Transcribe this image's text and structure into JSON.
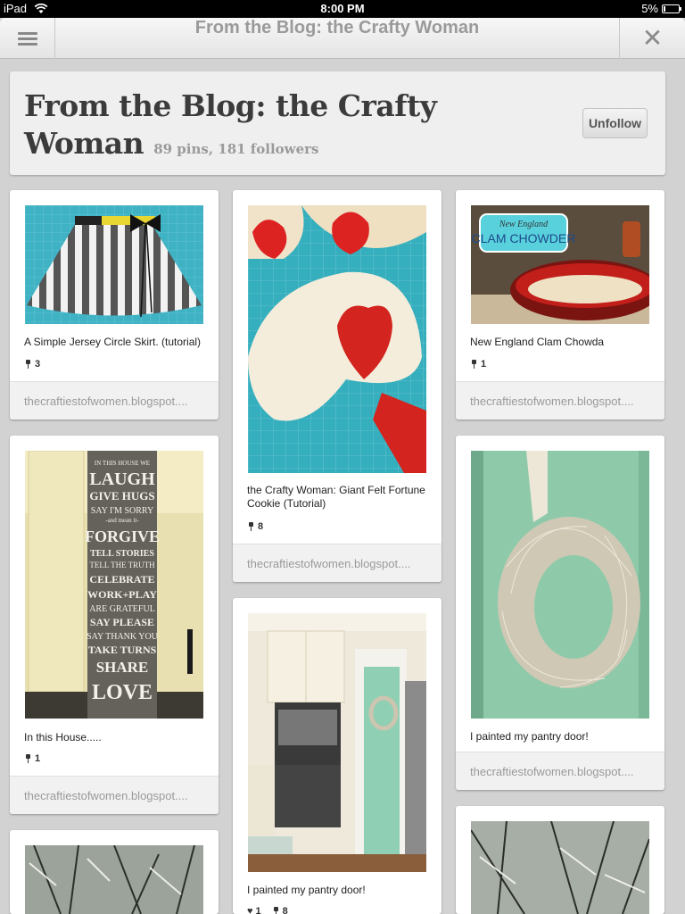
{
  "status_bar": {
    "device": "iPad",
    "time": "8:00 PM",
    "battery": "5%"
  },
  "nav": {
    "title": "From the Blog: the Crafty Woman"
  },
  "board": {
    "title": "From the Blog: the Crafty Woman",
    "stats": "89 pins, 181 followers",
    "unfollow_label": "Unfollow"
  },
  "pins": [
    {
      "description": "A Simple Jersey Circle Skirt. (tutorial)",
      "repins": "3",
      "source": "thecraftiestofwomen.blogspot...."
    },
    {
      "description": "New England Clam Chowda",
      "repins": "1",
      "source": "thecraftiestofwomen.blogspot...."
    },
    {
      "description": "the Crafty Woman: Giant Felt Fortune Cookie (Tutorial)",
      "repins": "8",
      "source": "thecraftiestofwomen.blogspot...."
    },
    {
      "description": "In this House.....",
      "repins": "1",
      "source": "thecraftiestofwomen.blogspot...."
    },
    {
      "description": "I painted my pantry door!",
      "source": "thecraftiestofwomen.blogspot...."
    },
    {
      "description": "I painted my pantry door!",
      "likes": "1",
      "repins": "8"
    }
  ],
  "image_text": {
    "clam_label_1": "New England",
    "clam_label_2": "CLAM CHOWDER",
    "house_sign": [
      "IN THIS HOUSE WE",
      "LAUGH",
      "GIVE HUGS",
      "SAY I'M SORRY",
      "-and mean it-",
      "FORGIVE",
      "TELL STORIES",
      "TELL THE TRUTH",
      "CELEBRATE",
      "WORK+PLAY",
      "ARE GRATEFUL",
      "SAY PLEASE",
      "SAY THANK YOU",
      "TAKE TURNS",
      "SHARE",
      "LOVE"
    ]
  }
}
